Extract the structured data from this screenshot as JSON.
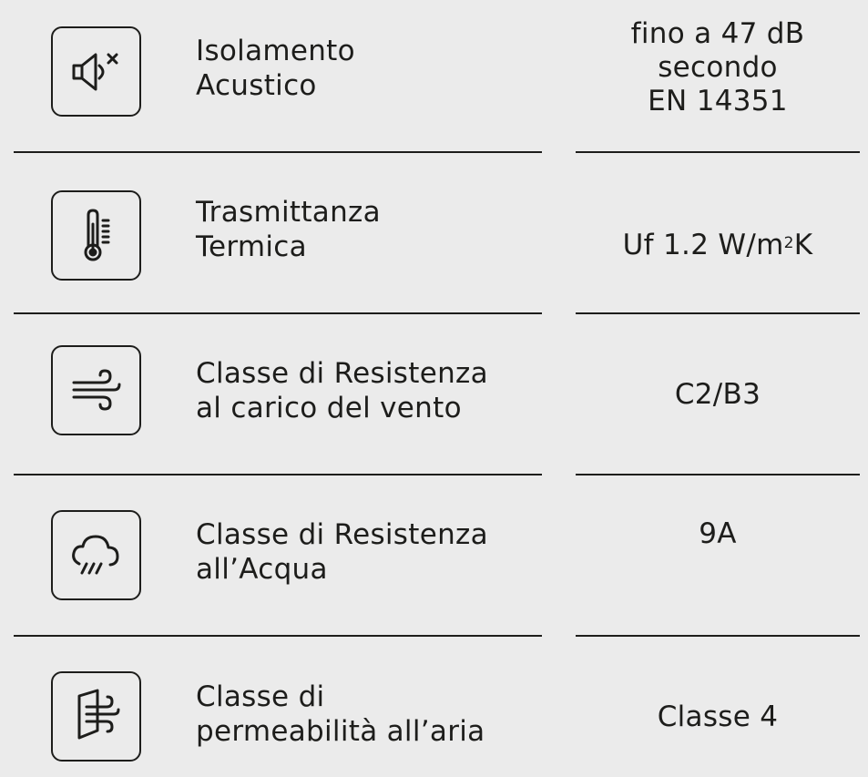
{
  "rows": [
    {
      "icon": "speaker-mute-icon",
      "label": "Isolamento\nAcustico",
      "value": "fino a 47 dB\nsecondo\nEN 14351"
    },
    {
      "icon": "thermometer-icon",
      "label": "Trasmittanza\nTermica",
      "value_main": "Uf 1.2 W/m",
      "value_sup": "2",
      "value_end": "K"
    },
    {
      "icon": "wind-icon",
      "label": "Classe di Resistenza\nal carico del vento",
      "value": "C2/B3"
    },
    {
      "icon": "rain-cloud-icon",
      "label": "Classe di Resistenza\nall’Acqua",
      "value": "9A"
    },
    {
      "icon": "air-window-icon",
      "label": "Classe di\npermeabilità all’aria",
      "value": "Classe 4"
    }
  ]
}
